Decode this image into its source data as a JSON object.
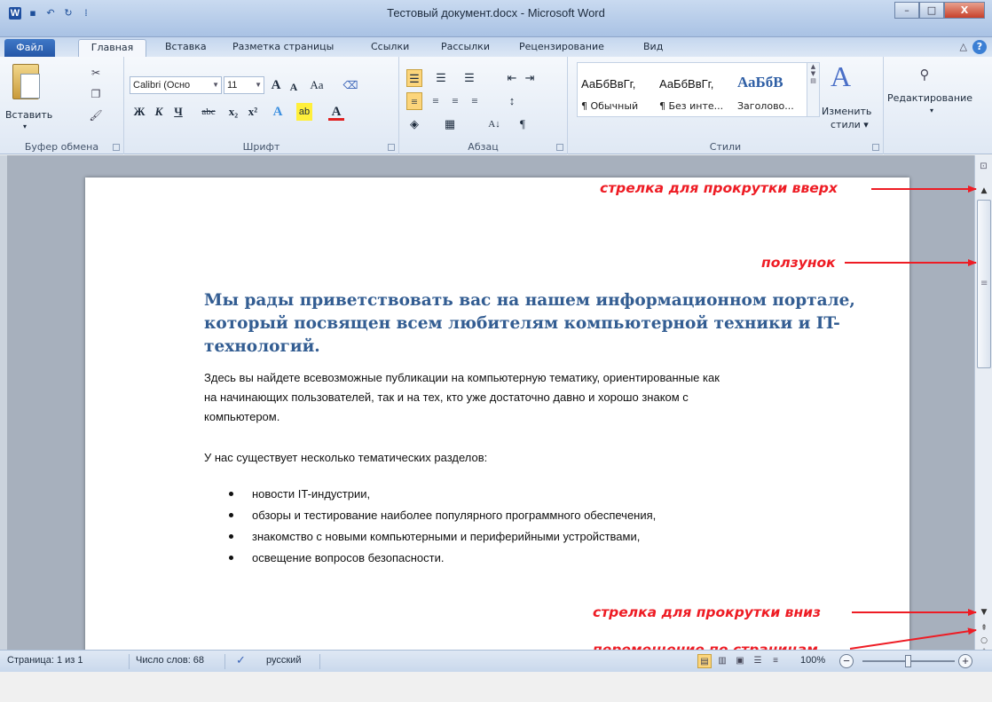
{
  "window": {
    "title": "Тестовый документ.docx - Microsoft Word",
    "minimize": "–",
    "maximize": "□",
    "close": "X"
  },
  "quick_access": {
    "app_icon": "W",
    "save": "▪",
    "undo": "↶",
    "redo": "↻",
    "customize": "⁞"
  },
  "tabs": {
    "file": "Файл",
    "items": [
      "Главная",
      "Вставка",
      "Разметка страницы",
      "Ссылки",
      "Рассылки",
      "Рецензирование",
      "Вид"
    ],
    "help": "?",
    "minimize_ribbon": "△"
  },
  "ribbon": {
    "clipboard": {
      "label": "Буфер обмена",
      "paste": "Вставить",
      "paste_arrow": "▾",
      "cut": "✂",
      "copy": "❐",
      "format_painter": "🖌"
    },
    "font": {
      "label": "Шрифт",
      "font_name": "Calibri (Осно",
      "font_size": "11",
      "grow": "A",
      "shrink": "A",
      "change_case": "Aa",
      "clear": "⌫",
      "bold": "Ж",
      "italic": "К",
      "underline": "Ч",
      "strike": "abc",
      "subscript": "x₂",
      "superscript": "x²",
      "effects": "A",
      "highlight": "ab",
      "font_color": "A"
    },
    "paragraph": {
      "label": "Абзац",
      "bullets": "☰",
      "numbering": "☰",
      "multilevel": "☰",
      "dec_indent": "⇤",
      "inc_indent": "⇥",
      "align_left": "≡",
      "align_center": "≡",
      "align_right": "≡",
      "justify": "≡",
      "line_spacing": "↕",
      "shading": "◈",
      "borders": "▦",
      "sort": "A↓",
      "pilcrow": "¶"
    },
    "styles": {
      "label": "Стили",
      "items": [
        {
          "sample": "АаБбВвГг,",
          "name": "¶ Обычный"
        },
        {
          "sample": "АаБбВвГг,",
          "name": "¶ Без инте..."
        },
        {
          "sample": "АаБбВ",
          "name": "Заголово..."
        }
      ],
      "change_styles": "Изменить",
      "change_styles_2": "стили ▾"
    },
    "editing": {
      "label": "Редактирование",
      "arrow": "▾"
    }
  },
  "document": {
    "heading_lines": [
      "Мы рады приветствовать вас на нашем информационном портале,",
      "который посвящен всем любителям компьютерной техники и IT-",
      "технологий."
    ],
    "para1_lines": [
      "Здесь вы найдете всевозможные публикации на компьютерную тематику, ориентированные как",
      "на начинающих пользователей, так и на тех, кто уже достаточно давно и хорошо знаком с",
      "компьютером."
    ],
    "para2": "У нас существует несколько тематических разделов:",
    "bullets": [
      "новости IT-индустрии,",
      "обзоры и тестирование наиболее популярного программного обеспечения,",
      "знакомство с новыми компьютерными и периферийными устройствами,",
      "освещение вопросов безопасности."
    ]
  },
  "annotations": {
    "scroll_up": "стрелка для прокрутки вверх",
    "thumb": "ползунок",
    "scroll_down": "стрелка для прокрутки вниз",
    "page_nav": "перемещение по страницам"
  },
  "scrollbar": {
    "up": "▲",
    "down": "▼",
    "grip": "≡",
    "prev_page": "⇞",
    "browse_object": "○",
    "next_page": "⇟",
    "ruler": "⊡"
  },
  "statusbar": {
    "page": "Страница: 1 из 1",
    "words": "Число слов: 68",
    "proofing_icon": "✓",
    "language": "русский",
    "views": [
      "▤",
      "▥",
      "▣",
      "☰",
      "≡"
    ],
    "zoom": "100%",
    "zoom_out": "−",
    "zoom_in": "+",
    "zoom_level": 0.5
  },
  "colors": {
    "accent": "#2557a7",
    "heading": "#335d92",
    "annotation": "#ee1c24"
  }
}
